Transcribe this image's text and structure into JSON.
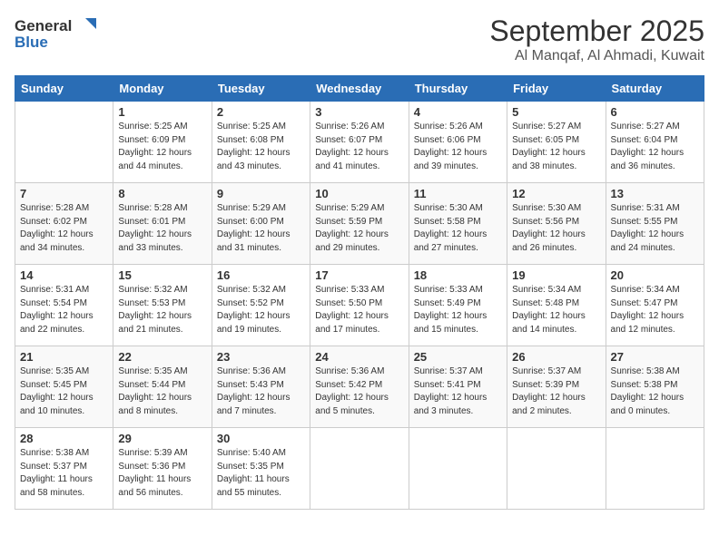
{
  "header": {
    "logo_general": "General",
    "logo_blue": "Blue",
    "month_title": "September 2025",
    "location": "Al Manqaf, Al Ahmadi, Kuwait"
  },
  "weekdays": [
    "Sunday",
    "Monday",
    "Tuesday",
    "Wednesday",
    "Thursday",
    "Friday",
    "Saturday"
  ],
  "weeks": [
    [
      {
        "day": "",
        "info": ""
      },
      {
        "day": "1",
        "info": "Sunrise: 5:25 AM\nSunset: 6:09 PM\nDaylight: 12 hours\nand 44 minutes."
      },
      {
        "day": "2",
        "info": "Sunrise: 5:25 AM\nSunset: 6:08 PM\nDaylight: 12 hours\nand 43 minutes."
      },
      {
        "day": "3",
        "info": "Sunrise: 5:26 AM\nSunset: 6:07 PM\nDaylight: 12 hours\nand 41 minutes."
      },
      {
        "day": "4",
        "info": "Sunrise: 5:26 AM\nSunset: 6:06 PM\nDaylight: 12 hours\nand 39 minutes."
      },
      {
        "day": "5",
        "info": "Sunrise: 5:27 AM\nSunset: 6:05 PM\nDaylight: 12 hours\nand 38 minutes."
      },
      {
        "day": "6",
        "info": "Sunrise: 5:27 AM\nSunset: 6:04 PM\nDaylight: 12 hours\nand 36 minutes."
      }
    ],
    [
      {
        "day": "7",
        "info": "Sunrise: 5:28 AM\nSunset: 6:02 PM\nDaylight: 12 hours\nand 34 minutes."
      },
      {
        "day": "8",
        "info": "Sunrise: 5:28 AM\nSunset: 6:01 PM\nDaylight: 12 hours\nand 33 minutes."
      },
      {
        "day": "9",
        "info": "Sunrise: 5:29 AM\nSunset: 6:00 PM\nDaylight: 12 hours\nand 31 minutes."
      },
      {
        "day": "10",
        "info": "Sunrise: 5:29 AM\nSunset: 5:59 PM\nDaylight: 12 hours\nand 29 minutes."
      },
      {
        "day": "11",
        "info": "Sunrise: 5:30 AM\nSunset: 5:58 PM\nDaylight: 12 hours\nand 27 minutes."
      },
      {
        "day": "12",
        "info": "Sunrise: 5:30 AM\nSunset: 5:56 PM\nDaylight: 12 hours\nand 26 minutes."
      },
      {
        "day": "13",
        "info": "Sunrise: 5:31 AM\nSunset: 5:55 PM\nDaylight: 12 hours\nand 24 minutes."
      }
    ],
    [
      {
        "day": "14",
        "info": "Sunrise: 5:31 AM\nSunset: 5:54 PM\nDaylight: 12 hours\nand 22 minutes."
      },
      {
        "day": "15",
        "info": "Sunrise: 5:32 AM\nSunset: 5:53 PM\nDaylight: 12 hours\nand 21 minutes."
      },
      {
        "day": "16",
        "info": "Sunrise: 5:32 AM\nSunset: 5:52 PM\nDaylight: 12 hours\nand 19 minutes."
      },
      {
        "day": "17",
        "info": "Sunrise: 5:33 AM\nSunset: 5:50 PM\nDaylight: 12 hours\nand 17 minutes."
      },
      {
        "day": "18",
        "info": "Sunrise: 5:33 AM\nSunset: 5:49 PM\nDaylight: 12 hours\nand 15 minutes."
      },
      {
        "day": "19",
        "info": "Sunrise: 5:34 AM\nSunset: 5:48 PM\nDaylight: 12 hours\nand 14 minutes."
      },
      {
        "day": "20",
        "info": "Sunrise: 5:34 AM\nSunset: 5:47 PM\nDaylight: 12 hours\nand 12 minutes."
      }
    ],
    [
      {
        "day": "21",
        "info": "Sunrise: 5:35 AM\nSunset: 5:45 PM\nDaylight: 12 hours\nand 10 minutes."
      },
      {
        "day": "22",
        "info": "Sunrise: 5:35 AM\nSunset: 5:44 PM\nDaylight: 12 hours\nand 8 minutes."
      },
      {
        "day": "23",
        "info": "Sunrise: 5:36 AM\nSunset: 5:43 PM\nDaylight: 12 hours\nand 7 minutes."
      },
      {
        "day": "24",
        "info": "Sunrise: 5:36 AM\nSunset: 5:42 PM\nDaylight: 12 hours\nand 5 minutes."
      },
      {
        "day": "25",
        "info": "Sunrise: 5:37 AM\nSunset: 5:41 PM\nDaylight: 12 hours\nand 3 minutes."
      },
      {
        "day": "26",
        "info": "Sunrise: 5:37 AM\nSunset: 5:39 PM\nDaylight: 12 hours\nand 2 minutes."
      },
      {
        "day": "27",
        "info": "Sunrise: 5:38 AM\nSunset: 5:38 PM\nDaylight: 12 hours\nand 0 minutes."
      }
    ],
    [
      {
        "day": "28",
        "info": "Sunrise: 5:38 AM\nSunset: 5:37 PM\nDaylight: 11 hours\nand 58 minutes."
      },
      {
        "day": "29",
        "info": "Sunrise: 5:39 AM\nSunset: 5:36 PM\nDaylight: 11 hours\nand 56 minutes."
      },
      {
        "day": "30",
        "info": "Sunrise: 5:40 AM\nSunset: 5:35 PM\nDaylight: 11 hours\nand 55 minutes."
      },
      {
        "day": "",
        "info": ""
      },
      {
        "day": "",
        "info": ""
      },
      {
        "day": "",
        "info": ""
      },
      {
        "day": "",
        "info": ""
      }
    ]
  ]
}
